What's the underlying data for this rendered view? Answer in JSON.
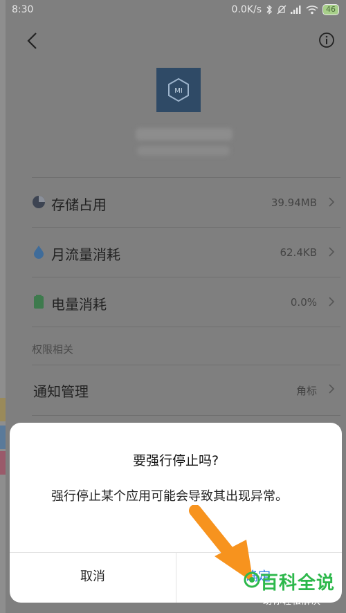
{
  "status_bar": {
    "time": "8:30",
    "net_speed": "0.0K/s",
    "battery": "46"
  },
  "app": {
    "icon_text": "MI"
  },
  "rows": [
    {
      "label": "存储占用",
      "value": "39.94MB",
      "icon": "pie-chart-icon"
    },
    {
      "label": "月流量消耗",
      "value": "62.4KB",
      "icon": "water-drop-icon"
    },
    {
      "label": "电量消耗",
      "value": "0.0%",
      "icon": "battery-icon"
    }
  ],
  "section_title": "权限相关",
  "notification": {
    "label": "通知管理",
    "value": "角标"
  },
  "dialog": {
    "title": "要强行停止吗?",
    "message": "强行停止某个应用可能会导致其出现异常。",
    "cancel": "取消",
    "confirm": "确定"
  },
  "watermark": {
    "title": "百科全说",
    "subtitle": "助你轻松解决"
  },
  "colors": {
    "dialog_bg": "#ffffff",
    "confirm_text": "#2a7ae2",
    "arrow": "#f7931e",
    "watermark_green": "#2db84b"
  }
}
